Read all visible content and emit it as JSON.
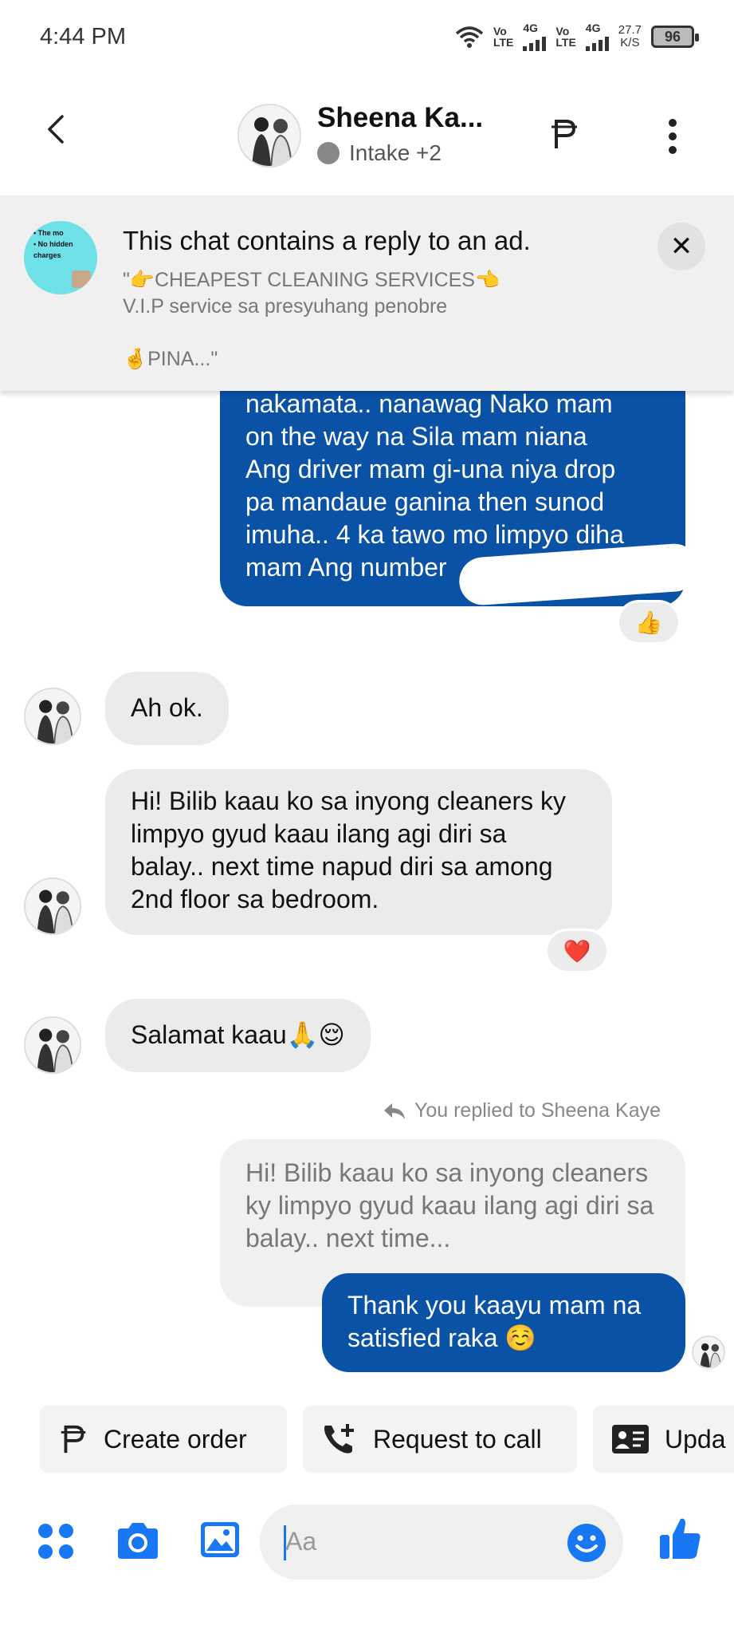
{
  "status_bar": {
    "time": "4:44 PM",
    "net1": {
      "top": "Vo",
      "bottom": "LTE",
      "gen": "4G"
    },
    "net2": {
      "top": "Vo",
      "bottom": "LTE",
      "gen": "4G"
    },
    "speed_value": "27.7",
    "speed_unit": "K/S",
    "battery": "96"
  },
  "header": {
    "contact_name": "Sheena Ka...",
    "label": "Intake +2"
  },
  "ad_banner": {
    "title": "This chat contains a reply to an ad.",
    "description": "\"👉CHEAPEST CLEANING SERVICES👈\nV.I.P service sa presyuhang penobre\n\n🤞PINA...\"",
    "thumb_text": "• The mo\n• No hidden\ncharges"
  },
  "messages": {
    "top_outgoing": "nakamata.. nanawag Nako mam\non the way na Sila mam niana\nAng driver mam gi-una niya drop\npa mandaue ganina then sunod\nimuha.. 4 ka tawo mo limpyo diha\nmam Ang number",
    "top_reaction": "👍",
    "incoming_1": "Ah ok.",
    "incoming_2": "Hi! Bilib kaau ko sa inyong cleaners ky limpyo gyud kaau ilang agi diri sa balay.. next time napud diri sa among 2nd floor sa bedroom.",
    "incoming_2_reaction": "❤️",
    "incoming_3": "Salamat kaau🙏😌",
    "reply_note": "You replied to Sheena Kaye",
    "quoted": "Hi! Bilib kaau ko sa inyong cleaners ky limpyo gyud kaau ilang agi diri sa balay.. next time...",
    "outgoing_reply": "Thank you kaayu mam na satisfied raka ☺️"
  },
  "quick_actions": {
    "create_order": "Create order",
    "request_call": "Request to call",
    "update": "Upda"
  },
  "composer": {
    "placeholder": "Aa"
  },
  "colors": {
    "outgoing_bubble": "#0a52a6",
    "accent": "#1877f2",
    "incoming_bubble": "#ebebeb"
  }
}
